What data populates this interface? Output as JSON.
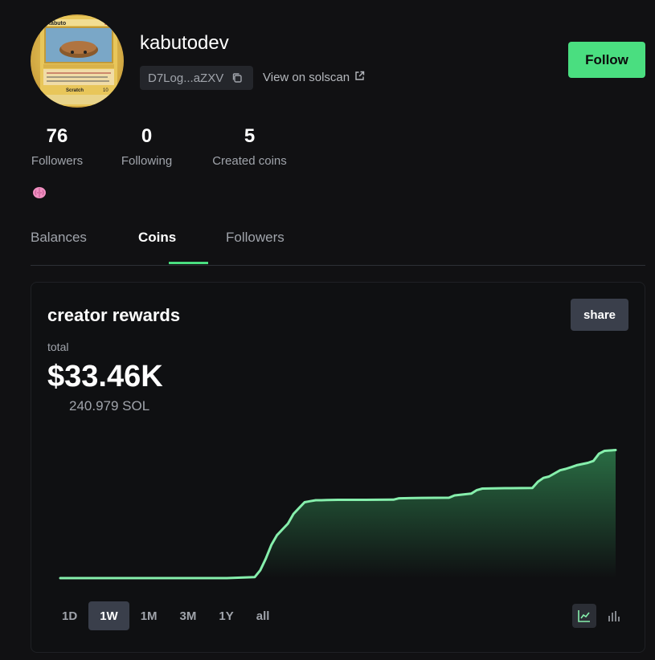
{
  "profile": {
    "username": "kabutodev",
    "address": "D7Log...aZXV",
    "solscan_label": "View on solscan",
    "follow_label": "Follow",
    "avatar_card": {
      "name": "Kabuto",
      "hp": "30",
      "attack": "Scratch",
      "damage": "10"
    }
  },
  "stats": [
    {
      "value": "76",
      "label": "Followers"
    },
    {
      "value": "0",
      "label": "Following"
    },
    {
      "value": "5",
      "label": "Created coins"
    }
  ],
  "badge_icon": "brain-icon",
  "tabs": {
    "items": [
      "Balances",
      "Coins",
      "Followers"
    ],
    "active": "Coins"
  },
  "rewards": {
    "title": "creator rewards",
    "share_label": "share",
    "total_label": "total",
    "total_value": "$33.46K",
    "sol_value": "240.979 SOL"
  },
  "ranges": {
    "items": [
      "1D",
      "1W",
      "1M",
      "3M",
      "1Y",
      "all"
    ],
    "active": "1W"
  },
  "view_toggle": {
    "options": [
      "line-chart-icon",
      "bar-chart-icon"
    ],
    "active": "line-chart-icon"
  },
  "colors": {
    "accent": "#4ade80",
    "background": "#111113",
    "button": "#3a3f4b"
  },
  "chart_data": {
    "type": "area",
    "x": [
      0,
      5,
      10,
      15,
      20,
      25,
      30,
      35,
      36,
      37,
      38,
      39,
      40,
      41,
      42,
      43,
      44,
      45,
      46,
      47,
      48,
      50,
      55,
      60,
      61,
      65,
      70,
      71,
      74,
      75,
      76,
      80,
      85,
      86,
      87,
      88,
      90,
      91,
      92,
      93,
      95,
      96,
      97,
      98,
      99,
      100
    ],
    "values": [
      0,
      0,
      0,
      0,
      0,
      0,
      0,
      0.5,
      4,
      10,
      17,
      22,
      25,
      28,
      33,
      36,
      39,
      39.5,
      40,
      40,
      40.1,
      40.2,
      40.2,
      40.3,
      41,
      41.2,
      41.3,
      42.5,
      43.4,
      45.2,
      46,
      46.2,
      46.3,
      49.5,
      51.5,
      52.2,
      55.4,
      56.1,
      57,
      58,
      59.2,
      60.2,
      63.9,
      65.4,
      65.6,
      65.8
    ],
    "ylim": [
      0,
      66
    ],
    "grid": false
  }
}
